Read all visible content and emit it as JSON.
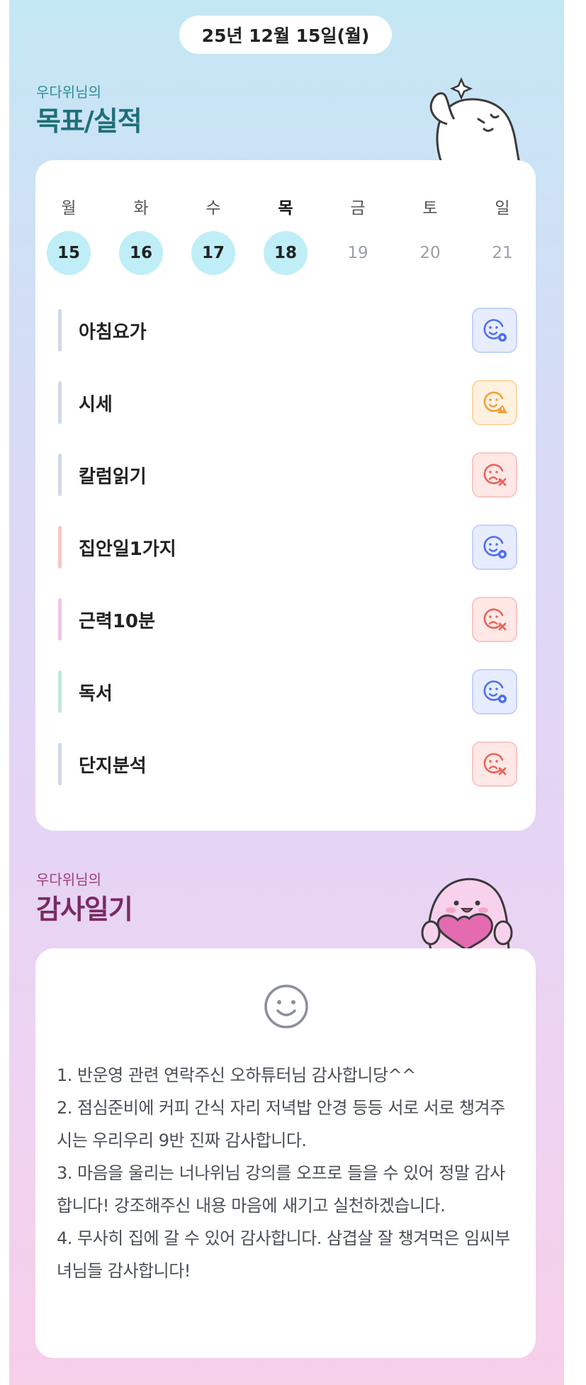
{
  "date_pill": "25년 12월 15일(월)",
  "goals_section": {
    "subtitle": "우다위님의",
    "title": "목표/실적",
    "week_days": [
      {
        "weekday": "월",
        "date": "15",
        "state": "done"
      },
      {
        "weekday": "화",
        "date": "16",
        "state": "done"
      },
      {
        "weekday": "수",
        "date": "17",
        "state": "done"
      },
      {
        "weekday": "목",
        "date": "18",
        "state": "done",
        "today": true
      },
      {
        "weekday": "금",
        "date": "19",
        "state": "future"
      },
      {
        "weekday": "토",
        "date": "20",
        "state": "future"
      },
      {
        "weekday": "일",
        "date": "21",
        "state": "future"
      }
    ],
    "goals": [
      {
        "label": "아침요가",
        "status": "good",
        "status_icon": "smile-check-icon",
        "bar_color": "#cfd9e8"
      },
      {
        "label": "시세",
        "status": "warn",
        "status_icon": "smile-warning-icon",
        "bar_color": "#cfd9e8"
      },
      {
        "label": "칼럼읽기",
        "status": "bad",
        "status_icon": "sad-x-icon",
        "bar_color": "#cfd9e8"
      },
      {
        "label": "집안일1가지",
        "status": "good",
        "status_icon": "smile-check-icon",
        "bar_color": "#f6c6c6"
      },
      {
        "label": "근력10분",
        "status": "bad",
        "status_icon": "sad-x-icon",
        "bar_color": "#f2c4e8"
      },
      {
        "label": "독서",
        "status": "good",
        "status_icon": "smile-check-icon",
        "bar_color": "#bfe9da"
      },
      {
        "label": "단지분석",
        "status": "bad",
        "status_icon": "sad-x-icon",
        "bar_color": "#cfd9e8"
      }
    ]
  },
  "gratitude_section": {
    "subtitle": "우다위님의",
    "title": "감사일기",
    "mood_icon": "smiley-face-icon",
    "entries": [
      "1. 반운영 관련 연락주신 오하튜터님 감사합니당^^",
      "2. 점심준비에 커피 간식 자리 저녁밥 안경 등등 서로 서로 챙겨주시는 우리우리 9반 진짜 감사합니다.",
      "3. 마음을 울리는 너나위님 강의를 오프로 들을 수 있어 정말 감사합니다! 강조해주신 내용 마음에 새기고 실천하겠습니다.",
      "4. 무사히 집에 갈 수 있어 감사합니다. 삼겹살 잘 챙겨먹은 임씨부녀님들 감사합니다!"
    ]
  },
  "colors": {
    "goals_subtitle": "#2d8d92",
    "goals_title": "#1e6f78",
    "gratitude_subtitle": "#9b3f7c",
    "gratitude_title": "#7a2a63",
    "status_good": "#4f6ef0",
    "status_warn": "#f0a03a",
    "status_bad": "#e8645a"
  }
}
